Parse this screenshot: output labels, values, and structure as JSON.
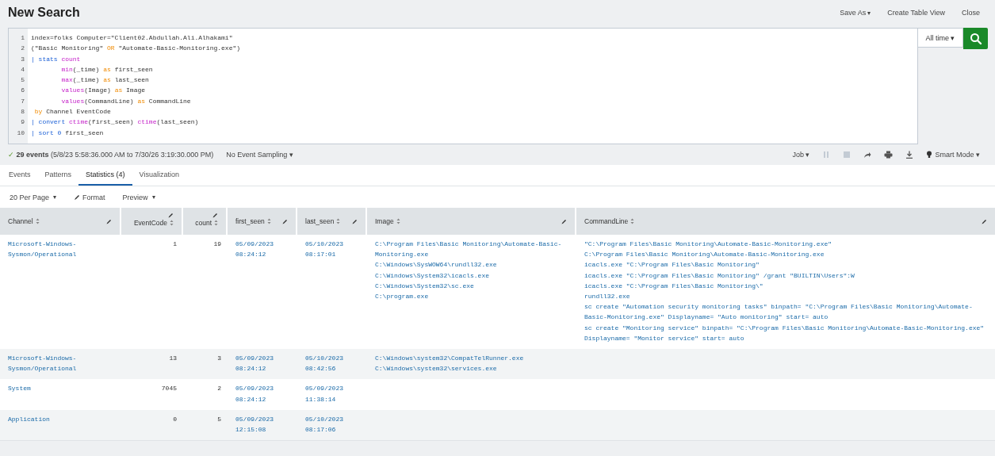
{
  "title": "New Search",
  "header_actions": [
    {
      "label": "Save As",
      "caret": "▾"
    },
    {
      "label": "Create Table View"
    },
    {
      "label": "Close"
    }
  ],
  "query": [
    {
      "number": "1",
      "tokens": [
        {
          "text": "index=folks Computer=\"Client02.Abdullah.Ali.Alhakami\"",
          "kind": "plain"
        }
      ]
    },
    {
      "number": "2",
      "tokens": [
        {
          "text": "(\"Basic Monitoring\" ",
          "kind": "plain"
        },
        {
          "text": "OR",
          "kind": "operator"
        },
        {
          "text": " \"Automate-Basic-Monitoring.exe\")",
          "kind": "plain"
        }
      ]
    },
    {
      "number": "3",
      "tokens": [
        {
          "text": "| stats ",
          "kind": "command"
        },
        {
          "text": "count",
          "kind": "function"
        }
      ]
    },
    {
      "number": "4",
      "tokens": [
        {
          "text": "        min",
          "kind": "function"
        },
        {
          "text": "(_time) ",
          "kind": "plain"
        },
        {
          "text": "as",
          "kind": "operator"
        },
        {
          "text": " first_seen",
          "kind": "plain"
        }
      ]
    },
    {
      "number": "5",
      "tokens": [
        {
          "text": "        max",
          "kind": "function"
        },
        {
          "text": "(_time) ",
          "kind": "plain"
        },
        {
          "text": "as",
          "kind": "operator"
        },
        {
          "text": " last_seen",
          "kind": "plain"
        }
      ]
    },
    {
      "number": "6",
      "tokens": [
        {
          "text": "        values",
          "kind": "function"
        },
        {
          "text": "(Image) ",
          "kind": "plain"
        },
        {
          "text": "as",
          "kind": "operator"
        },
        {
          "text": " Image",
          "kind": "plain"
        }
      ]
    },
    {
      "number": "7",
      "tokens": [
        {
          "text": "        values",
          "kind": "function"
        },
        {
          "text": "(CommandLine) ",
          "kind": "plain"
        },
        {
          "text": "as",
          "kind": "operator"
        },
        {
          "text": " CommandLine",
          "kind": "plain"
        }
      ]
    },
    {
      "number": "8",
      "tokens": [
        {
          "text": " by",
          "kind": "operator"
        },
        {
          "text": " Channel EventCode",
          "kind": "plain"
        }
      ]
    },
    {
      "number": "9",
      "tokens": [
        {
          "text": "| convert ",
          "kind": "command"
        },
        {
          "text": "ctime",
          "kind": "function"
        },
        {
          "text": "(first_seen) ",
          "kind": "plain"
        },
        {
          "text": "ctime",
          "kind": "function"
        },
        {
          "text": "(last_seen)",
          "kind": "plain"
        }
      ]
    },
    {
      "number": "10",
      "tokens": [
        {
          "text": "| sort 0 ",
          "kind": "command"
        },
        {
          "text": "first_seen",
          "kind": "plain"
        }
      ]
    }
  ],
  "time_picker": {
    "label": "All time",
    "caret": "▾"
  },
  "status": {
    "tick": "✓",
    "count": "29 events",
    "range": "(5/8/23 5:58:36.000 AM to 7/30/26 3:19:30.000 PM)",
    "sampling": "No Event Sampling",
    "sampling_caret": "▾"
  },
  "job": {
    "label": "Job",
    "caret": "▾",
    "mode": "Smart Mode",
    "mode_caret": "▾"
  },
  "tabs": [
    {
      "label": "Events",
      "selected": false
    },
    {
      "label": "Patterns",
      "selected": false
    },
    {
      "label": "Statistics (4)",
      "selected": true
    },
    {
      "label": "Visualization",
      "selected": false
    }
  ],
  "table_options": [
    {
      "label": "20 Per Page",
      "kind": "dropdown",
      "caret": "▾"
    },
    {
      "label": "Format",
      "kind": "edit"
    },
    {
      "label": "Preview",
      "kind": "dropdown",
      "caret": "▾"
    }
  ],
  "table": {
    "columns": [
      {
        "label": "Channel",
        "numeric": false
      },
      {
        "label": "EventCode",
        "numeric": true
      },
      {
        "label": "count",
        "numeric": true
      },
      {
        "label": "first_seen",
        "numeric": false
      },
      {
        "label": "last_seen",
        "numeric": false
      },
      {
        "label": "Image",
        "numeric": false
      },
      {
        "label": "CommandLine",
        "numeric": false
      }
    ],
    "rows": [
      {
        "cells": [
          "Microsoft-Windows-Sysmon/Operational",
          "1",
          "19",
          "05/09/2023 08:24:12",
          "05/10/2023 08:17:01",
          [
            "C:\\Program Files\\Basic Monitoring\\Automate-Basic-Monitoring.exe",
            "C:\\Windows\\SysWOW64\\rundll32.exe",
            "C:\\Windows\\System32\\icacls.exe",
            "C:\\Windows\\System32\\sc.exe",
            "C:\\program.exe"
          ],
          [
            "\"C:\\Program Files\\Basic Monitoring\\Automate-Basic-Monitoring.exe\"",
            "C:\\Program Files\\Basic Monitoring\\Automate-Basic-Monitoring.exe",
            "icacls.exe  \"C:\\Program Files\\Basic Monitoring\"",
            "icacls.exe  \"C:\\Program Files\\Basic Monitoring\" /grant \"BUILTIN\\Users\":W",
            "icacls.exe  \"C:\\Program Files\\Basic Monitoring\\\"",
            "rundll32.exe",
            "sc  create \"Automation security monitoring tasks\" binpath= \"C:\\Program Files\\Basic Monitoring\\Automate-Basic-Monitoring.exe\" Displayname= \"Auto monitoring\" start= auto",
            "sc  create \"Monitoring service\" binpath= \"C:\\Program Files\\Basic Monitoring\\Automate-Basic-Monitoring.exe\" Displayname= \"Monitor service\" start= auto"
          ]
        ]
      },
      {
        "cells": [
          "Microsoft-Windows-Sysmon/Operational",
          "13",
          "3",
          "05/09/2023 08:24:12",
          "05/10/2023 08:42:56",
          [
            "C:\\Windows\\system32\\CompatTelRunner.exe",
            "C:\\Windows\\system32\\services.exe"
          ]
        ]
      },
      {
        "cells": [
          "System",
          "7045",
          "2",
          "05/09/2023 08:24:12",
          "05/09/2023 11:38:14"
        ]
      },
      {
        "cells": [
          "Application",
          "0",
          "5",
          "05/09/2023 12:15:08",
          "05/10/2023 08:17:06"
        ]
      }
    ]
  }
}
